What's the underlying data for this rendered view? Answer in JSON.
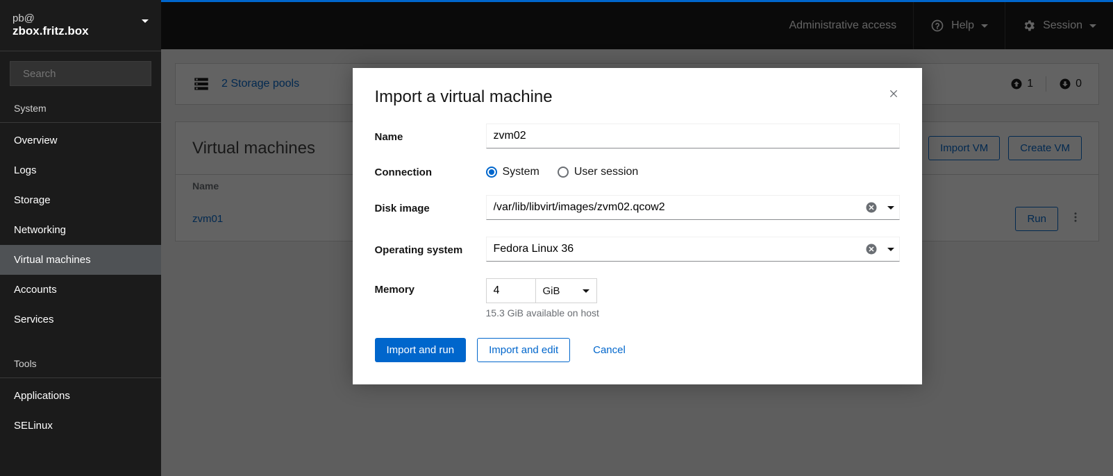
{
  "host": {
    "user": "pb@",
    "name": "zbox.fritz.box"
  },
  "search": {
    "placeholder": "Search"
  },
  "sidebar": {
    "sections": [
      {
        "label": "System",
        "items": [
          {
            "label": "Overview"
          },
          {
            "label": "Logs"
          },
          {
            "label": "Storage"
          },
          {
            "label": "Networking"
          },
          {
            "label": "Virtual machines",
            "active": true
          },
          {
            "label": "Accounts"
          },
          {
            "label": "Services"
          }
        ]
      },
      {
        "label": "Tools",
        "items": [
          {
            "label": "Applications"
          },
          {
            "label": "SELinux"
          }
        ]
      }
    ]
  },
  "topbar": {
    "admin": "Administrative access",
    "help": "Help",
    "session": "Session"
  },
  "main": {
    "storage_pools": "2 Storage pools",
    "running": "1",
    "stopped": "0",
    "title": "Virtual machines",
    "import_btn": "Import VM",
    "create_btn": "Create VM",
    "col_name": "Name",
    "rows": [
      {
        "name": "zvm01",
        "action": "Run"
      }
    ]
  },
  "modal": {
    "title": "Import a virtual machine",
    "labels": {
      "name": "Name",
      "connection": "Connection",
      "disk": "Disk image",
      "os": "Operating system",
      "memory": "Memory"
    },
    "values": {
      "name": "zvm02",
      "conn_system": "System",
      "conn_user": "User session",
      "disk": "/var/lib/libvirt/images/zvm02.qcow2",
      "os": "Fedora Linux 36",
      "memory": "4",
      "memory_unit": "GiB",
      "memory_hint": "15.3 GiB available on host"
    },
    "buttons": {
      "run": "Import and run",
      "edit": "Import and edit",
      "cancel": "Cancel"
    }
  }
}
